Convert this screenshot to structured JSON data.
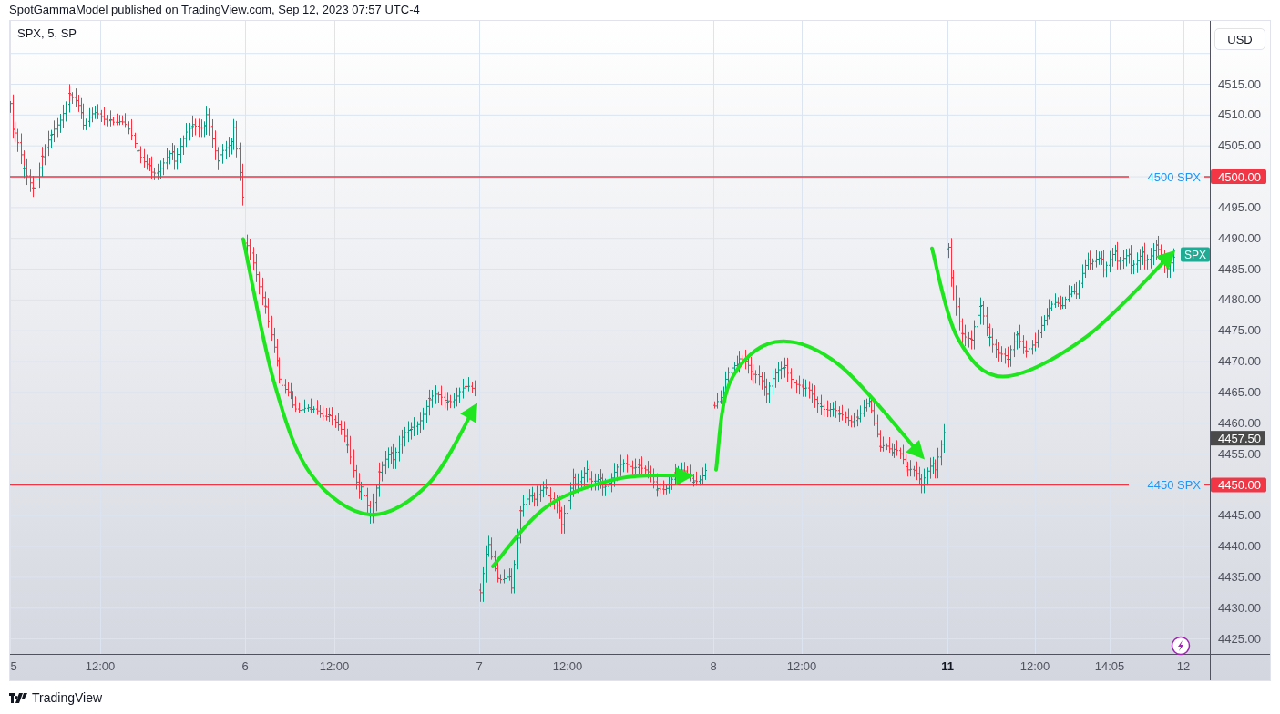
{
  "header": {
    "text": "SpotGammaModel published on TradingView.com, Sep 12, 2023 07:57 UTC-4"
  },
  "chart": {
    "legend": "SPX, 5, SP",
    "currency_button": "USD",
    "price_axis": [
      "4515.00",
      "4510.00",
      "4505.00",
      "4495.00",
      "4490.00",
      "4485.00",
      "4480.00",
      "4475.00",
      "4470.00",
      "4465.00",
      "4460.00",
      "4455.00",
      "4445.00",
      "4440.00",
      "4435.00",
      "4430.00",
      "4425.00"
    ],
    "time_axis": [
      {
        "label": "5",
        "emphasized": false
      },
      {
        "label": "12:00",
        "emphasized": false
      },
      {
        "label": "6",
        "emphasized": false
      },
      {
        "label": "12:00",
        "emphasized": false
      },
      {
        "label": "7",
        "emphasized": false
      },
      {
        "label": "12:00",
        "emphasized": false
      },
      {
        "label": "8",
        "emphasized": false
      },
      {
        "label": "12:00",
        "emphasized": false
      },
      {
        "label": "11",
        "emphasized": true
      },
      {
        "label": "12:00",
        "emphasized": false
      },
      {
        "label": "14:05",
        "emphasized": false
      },
      {
        "label": "12",
        "emphasized": false
      }
    ],
    "levels": [
      {
        "label": "4500 SPX",
        "price": "4500.00",
        "color": "#f23645"
      },
      {
        "label": "4450 SPX",
        "price": "4450.00",
        "color": "#f23645"
      }
    ],
    "symbol_badge": {
      "label": "SPX",
      "color": "#22ab94"
    },
    "last_price": {
      "label": "4457.50"
    }
  },
  "footer": {
    "brand": "TradingView"
  }
}
